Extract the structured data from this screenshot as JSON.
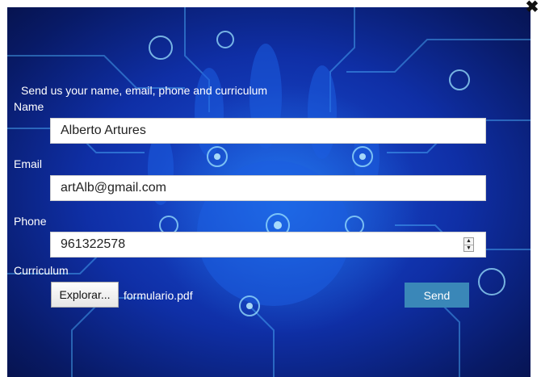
{
  "dialog": {
    "close_glyph": "✖",
    "intro": "Send us your name, email, phone and curriculum"
  },
  "form": {
    "name_label": "Name",
    "name_value": "Alberto Artures",
    "email_label": "Email",
    "email_value": "artAlb@gmail.com",
    "phone_label": "Phone",
    "phone_value": "961322578",
    "curriculum_label": "Curriculum",
    "file_button_label": "Explorar...",
    "file_name": "formulario.pdf",
    "send_label": "Send"
  },
  "colors": {
    "background_deep": "#081a66",
    "background_glow": "#2896ff",
    "send_button": "#3a87b8",
    "text_on_background": "#ffffff"
  }
}
